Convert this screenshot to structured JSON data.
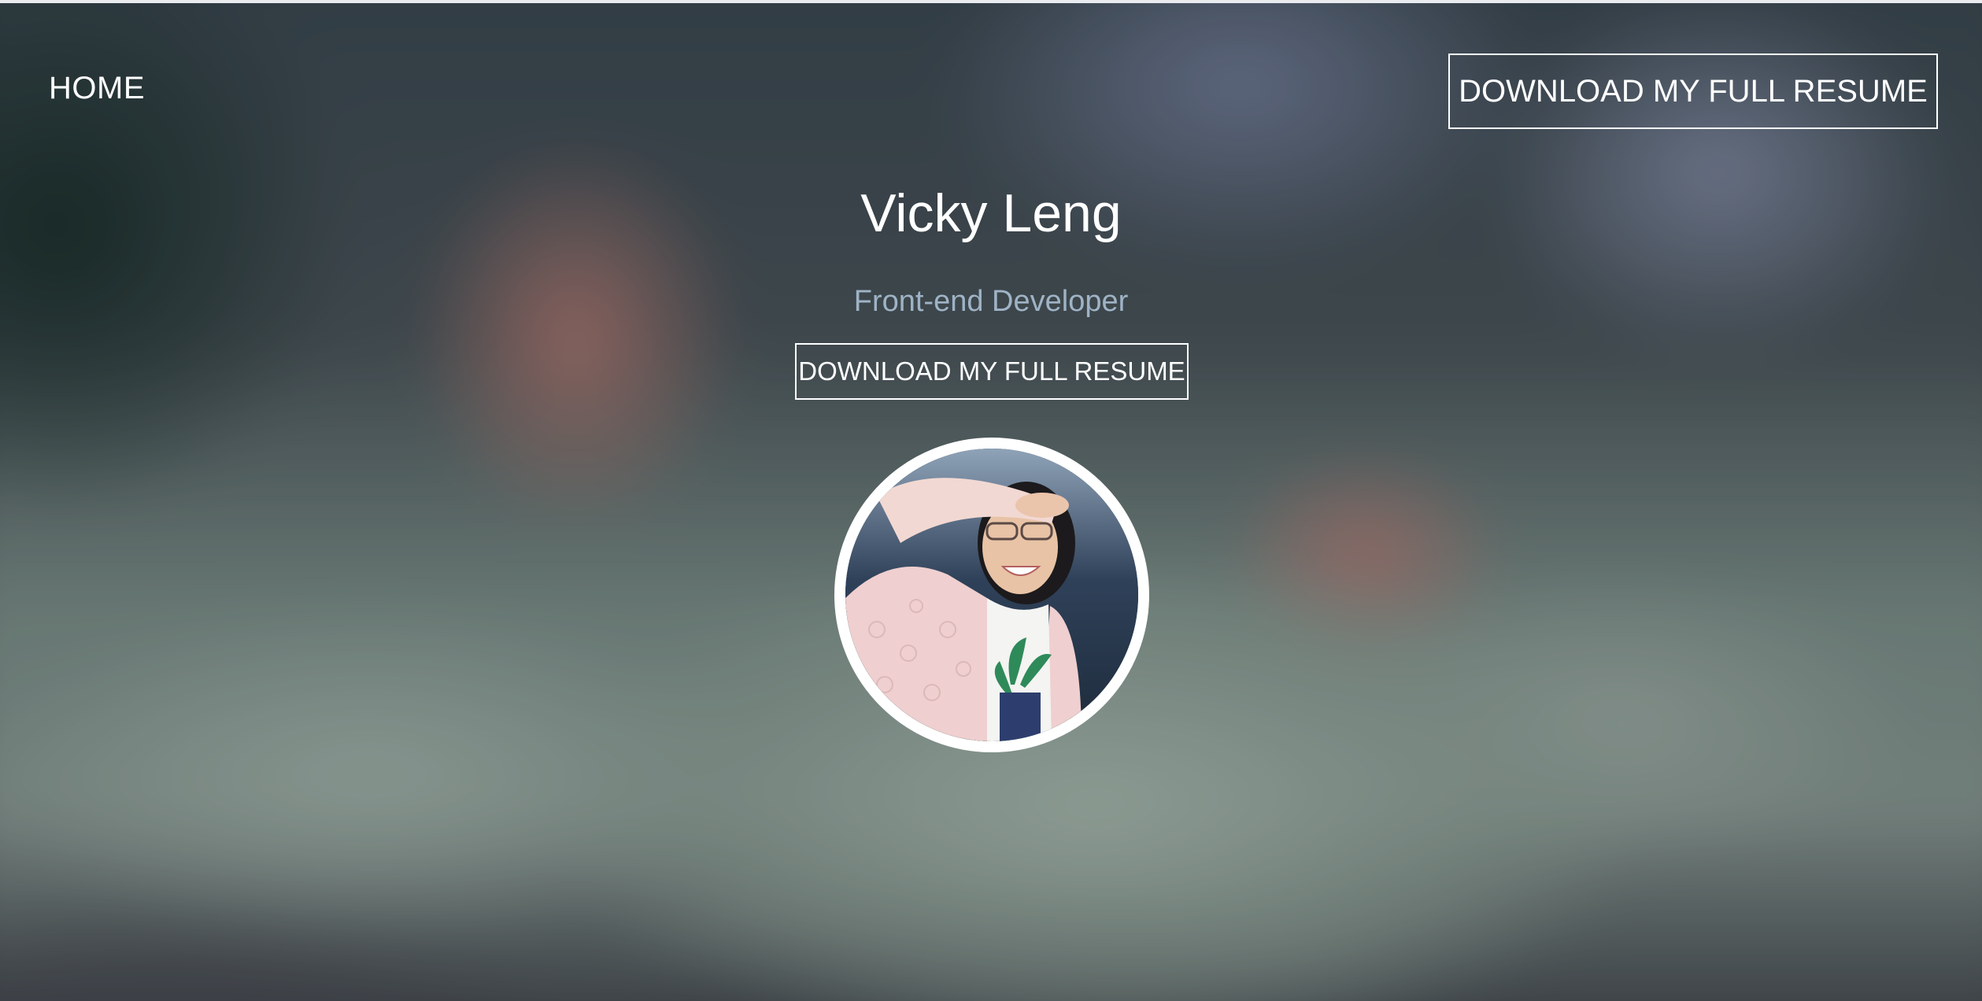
{
  "nav": {
    "home_label": "HOME",
    "download_label": "DOWNLOAD MY FULL RESUME"
  },
  "hero": {
    "name": "Vicky Leng",
    "role": "Front-end Developer",
    "download_label": "DOWNLOAD MY FULL RESUME"
  },
  "colors": {
    "text": "#ffffff",
    "role_text": "#9fb3c6",
    "avatar_border": "#ffffff"
  }
}
